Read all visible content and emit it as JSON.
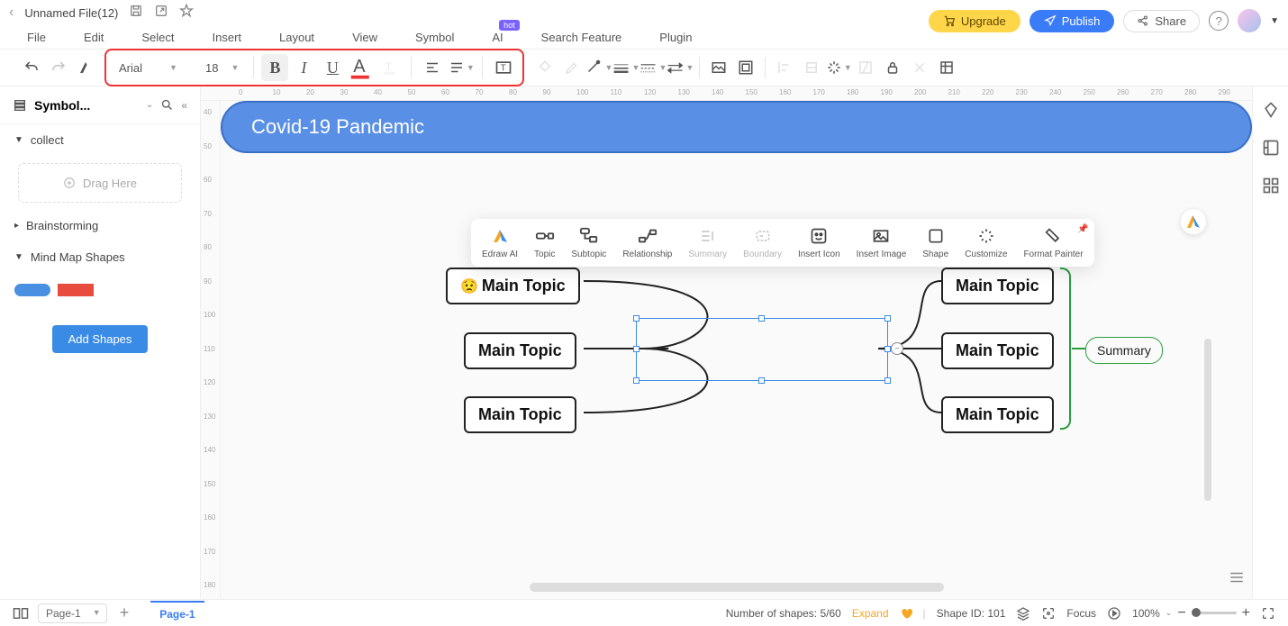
{
  "header": {
    "filename": "Unnamed File(12)",
    "upgrade": "Upgrade",
    "publish": "Publish",
    "share": "Share"
  },
  "menu": {
    "file": "File",
    "edit": "Edit",
    "select": "Select",
    "insert": "Insert",
    "layout": "Layout",
    "view": "View",
    "symbol": "Symbol",
    "ai": "AI",
    "ai_badge": "hot",
    "search": "Search Feature",
    "plugin": "Plugin"
  },
  "toolbar": {
    "font_family": "Arial",
    "font_size": "18"
  },
  "sidebar": {
    "title": "Symbol...",
    "collect": "collect",
    "drag": "Drag Here",
    "brainstorm": "Brainstorming",
    "mindmap": "Mind Map Shapes",
    "add_shapes": "Add Shapes"
  },
  "ctx": {
    "edraw_ai": "Edraw AI",
    "topic": "Topic",
    "subtopic": "Subtopic",
    "relationship": "Relationship",
    "summary": "Summary",
    "boundary": "Boundary",
    "insert_icon": "Insert Icon",
    "insert_image": "Insert Image",
    "shape": "Shape",
    "customize": "Customize",
    "format_painter": "Format Painter"
  },
  "mindmap": {
    "center": "Covid-19 Pandemic",
    "topic1": "Main Topic",
    "topic2": "Main Topic",
    "topic3": "Main Topic",
    "topic4": "Main Topic",
    "topic5": "Main Topic",
    "topic6": "Main Topic",
    "summary": "Summary"
  },
  "ruler_top": [
    "0",
    "10",
    "20",
    "30",
    "40",
    "50",
    "60",
    "70",
    "80",
    "90",
    "100",
    "110",
    "120",
    "130",
    "140",
    "150",
    "160",
    "170",
    "180",
    "190",
    "200",
    "210",
    "220",
    "230",
    "240",
    "250",
    "260",
    "270",
    "280",
    "290"
  ],
  "ruler_left": [
    "40",
    "50",
    "60",
    "70",
    "80",
    "90",
    "100",
    "110",
    "120",
    "130",
    "140",
    "150",
    "160",
    "170",
    "180"
  ],
  "footer": {
    "page_sel": "Page-1",
    "page_tab": "Page-1",
    "shapes_count": "Number of shapes: 5/60",
    "expand": "Expand",
    "shape_id": "Shape ID: 101",
    "focus": "Focus",
    "zoom": "100%"
  }
}
